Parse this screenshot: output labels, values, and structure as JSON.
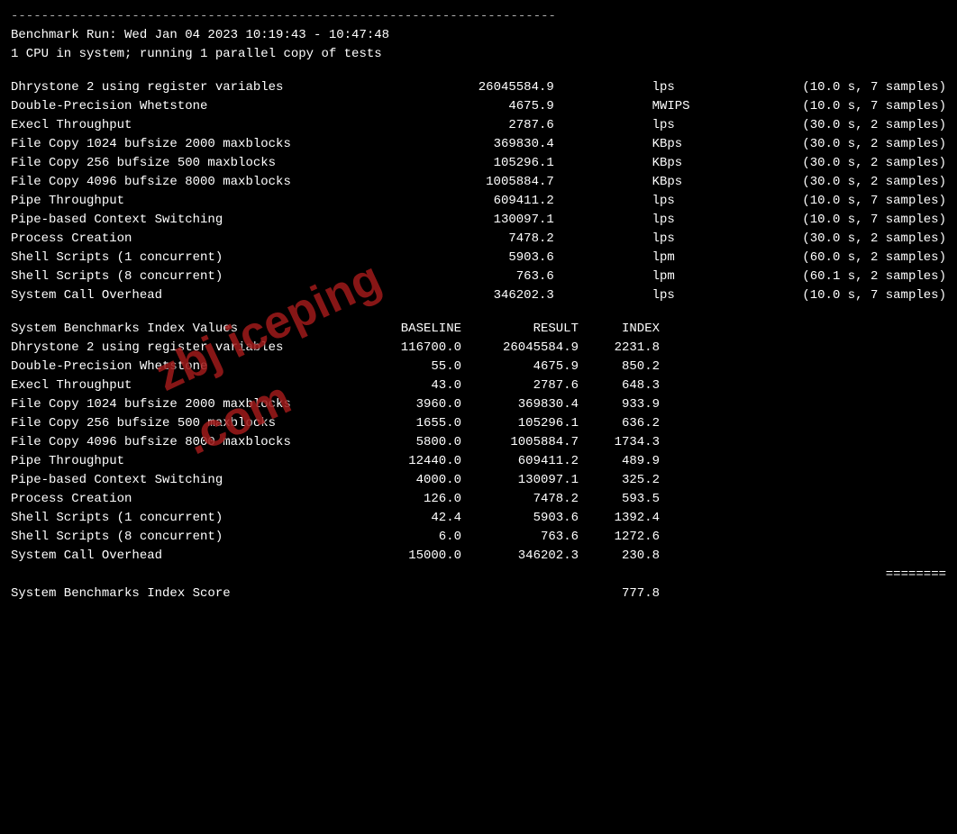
{
  "dashed_line": "------------------------------------------------------------------------",
  "header": {
    "line1": "Benchmark Run: Wed Jan 04 2023 10:19:43 - 10:47:48",
    "line2": "1 CPU in system; running 1 parallel copy of tests"
  },
  "raw_results": [
    {
      "name": "Dhrystone 2 using register variables",
      "value": "26045584.9",
      "unit": "lps",
      "meta": "(10.0 s, 7 samples)"
    },
    {
      "name": "Double-Precision Whetstone",
      "value": "4675.9",
      "unit": "MWIPS",
      "meta": "(10.0 s, 7 samples)"
    },
    {
      "name": "Execl Throughput",
      "value": "2787.6",
      "unit": "lps",
      "meta": "(30.0 s, 2 samples)"
    },
    {
      "name": "File Copy 1024 bufsize 2000 maxblocks",
      "value": "369830.4",
      "unit": "KBps",
      "meta": "(30.0 s, 2 samples)"
    },
    {
      "name": "File Copy 256 bufsize 500 maxblocks",
      "value": "105296.1",
      "unit": "KBps",
      "meta": "(30.0 s, 2 samples)"
    },
    {
      "name": "File Copy 4096 bufsize 8000 maxblocks",
      "value": "1005884.7",
      "unit": "KBps",
      "meta": "(30.0 s, 2 samples)"
    },
    {
      "name": "Pipe Throughput",
      "value": "609411.2",
      "unit": "lps",
      "meta": "(10.0 s, 7 samples)"
    },
    {
      "name": "Pipe-based Context Switching",
      "value": "130097.1",
      "unit": "lps",
      "meta": "(10.0 s, 7 samples)"
    },
    {
      "name": "Process Creation",
      "value": "7478.2",
      "unit": "lps",
      "meta": "(30.0 s, 2 samples)"
    },
    {
      "name": "Shell Scripts (1 concurrent)",
      "value": "5903.6",
      "unit": "lpm",
      "meta": "(60.0 s, 2 samples)"
    },
    {
      "name": "Shell Scripts (8 concurrent)",
      "value": "763.6",
      "unit": "lpm",
      "meta": "(60.1 s, 2 samples)"
    },
    {
      "name": "System Call Overhead",
      "value": "346202.3",
      "unit": "lps",
      "meta": "(10.0 s, 7 samples)"
    }
  ],
  "index_header": {
    "name_label": "System Benchmarks Index Values",
    "baseline_label": "BASELINE",
    "result_label": "RESULT",
    "index_label": "INDEX"
  },
  "index_results": [
    {
      "name": "Dhrystone 2 using register variables",
      "baseline": "116700.0",
      "result": "26045584.9",
      "index": "2231.8"
    },
    {
      "name": "Double-Precision Whetstone",
      "baseline": "55.0",
      "result": "4675.9",
      "index": "850.2"
    },
    {
      "name": "Execl Throughput",
      "baseline": "43.0",
      "result": "2787.6",
      "index": "648.3"
    },
    {
      "name": "File Copy 1024 bufsize 2000 maxblocks",
      "baseline": "3960.0",
      "result": "369830.4",
      "index": "933.9"
    },
    {
      "name": "File Copy 256 bufsize 500 maxblocks",
      "baseline": "1655.0",
      "result": "105296.1",
      "index": "636.2"
    },
    {
      "name": "File Copy 4096 bufsize 8000 maxblocks",
      "baseline": "5800.0",
      "result": "1005884.7",
      "index": "1734.3"
    },
    {
      "name": "Pipe Throughput",
      "baseline": "12440.0",
      "result": "609411.2",
      "index": "489.9"
    },
    {
      "name": "Pipe-based Context Switching",
      "baseline": "4000.0",
      "result": "130097.1",
      "index": "325.2"
    },
    {
      "name": "Process Creation",
      "baseline": "126.0",
      "result": "7478.2",
      "index": "593.5"
    },
    {
      "name": "Shell Scripts (1 concurrent)",
      "baseline": "42.4",
      "result": "5903.6",
      "index": "1392.4"
    },
    {
      "name": "Shell Scripts (8 concurrent)",
      "baseline": "6.0",
      "result": "763.6",
      "index": "1272.6"
    },
    {
      "name": "System Call Overhead",
      "baseline": "15000.0",
      "result": "346202.3",
      "index": "230.8"
    }
  ],
  "equals_line": "========",
  "score": {
    "label": "System Benchmarks Index Score",
    "value": "777.8"
  },
  "watermark": {
    "line1": "zbj iceping",
    "line2": ".com"
  }
}
